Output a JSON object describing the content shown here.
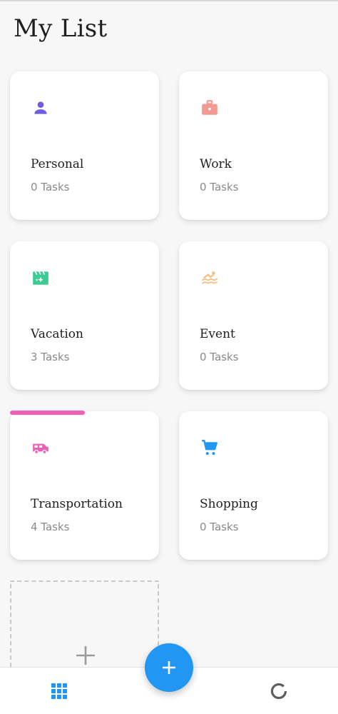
{
  "header": {
    "title": "My List"
  },
  "categories": [
    {
      "name": "Personal",
      "count": "0 Tasks",
      "icon": "person-icon",
      "color": "#6f5de0"
    },
    {
      "name": "Work",
      "count": "0 Tasks",
      "icon": "briefcase-icon",
      "color": "#f29a92"
    },
    {
      "name": "Vacation",
      "count": "3 Tasks",
      "icon": "movie-icon",
      "color": "#3ecb93"
    },
    {
      "name": "Event",
      "count": "0 Tasks",
      "icon": "swimmer-icon",
      "color": "#f3c28b"
    },
    {
      "name": "Transportation",
      "count": "4 Tasks",
      "icon": "van-icon",
      "color": "#ee5fb6",
      "progress": 0.5
    },
    {
      "name": "Shopping",
      "count": "0 Tasks",
      "icon": "cart-icon",
      "color": "#2196f3"
    }
  ],
  "add_card": {
    "icon": "plus-icon"
  },
  "fab": {
    "icon": "plus-icon",
    "color": "#2196f3"
  },
  "bottom_nav": {
    "left_icon": "grid-icon",
    "right_icon": "progress-ring-icon",
    "accent": "#2196f3"
  }
}
